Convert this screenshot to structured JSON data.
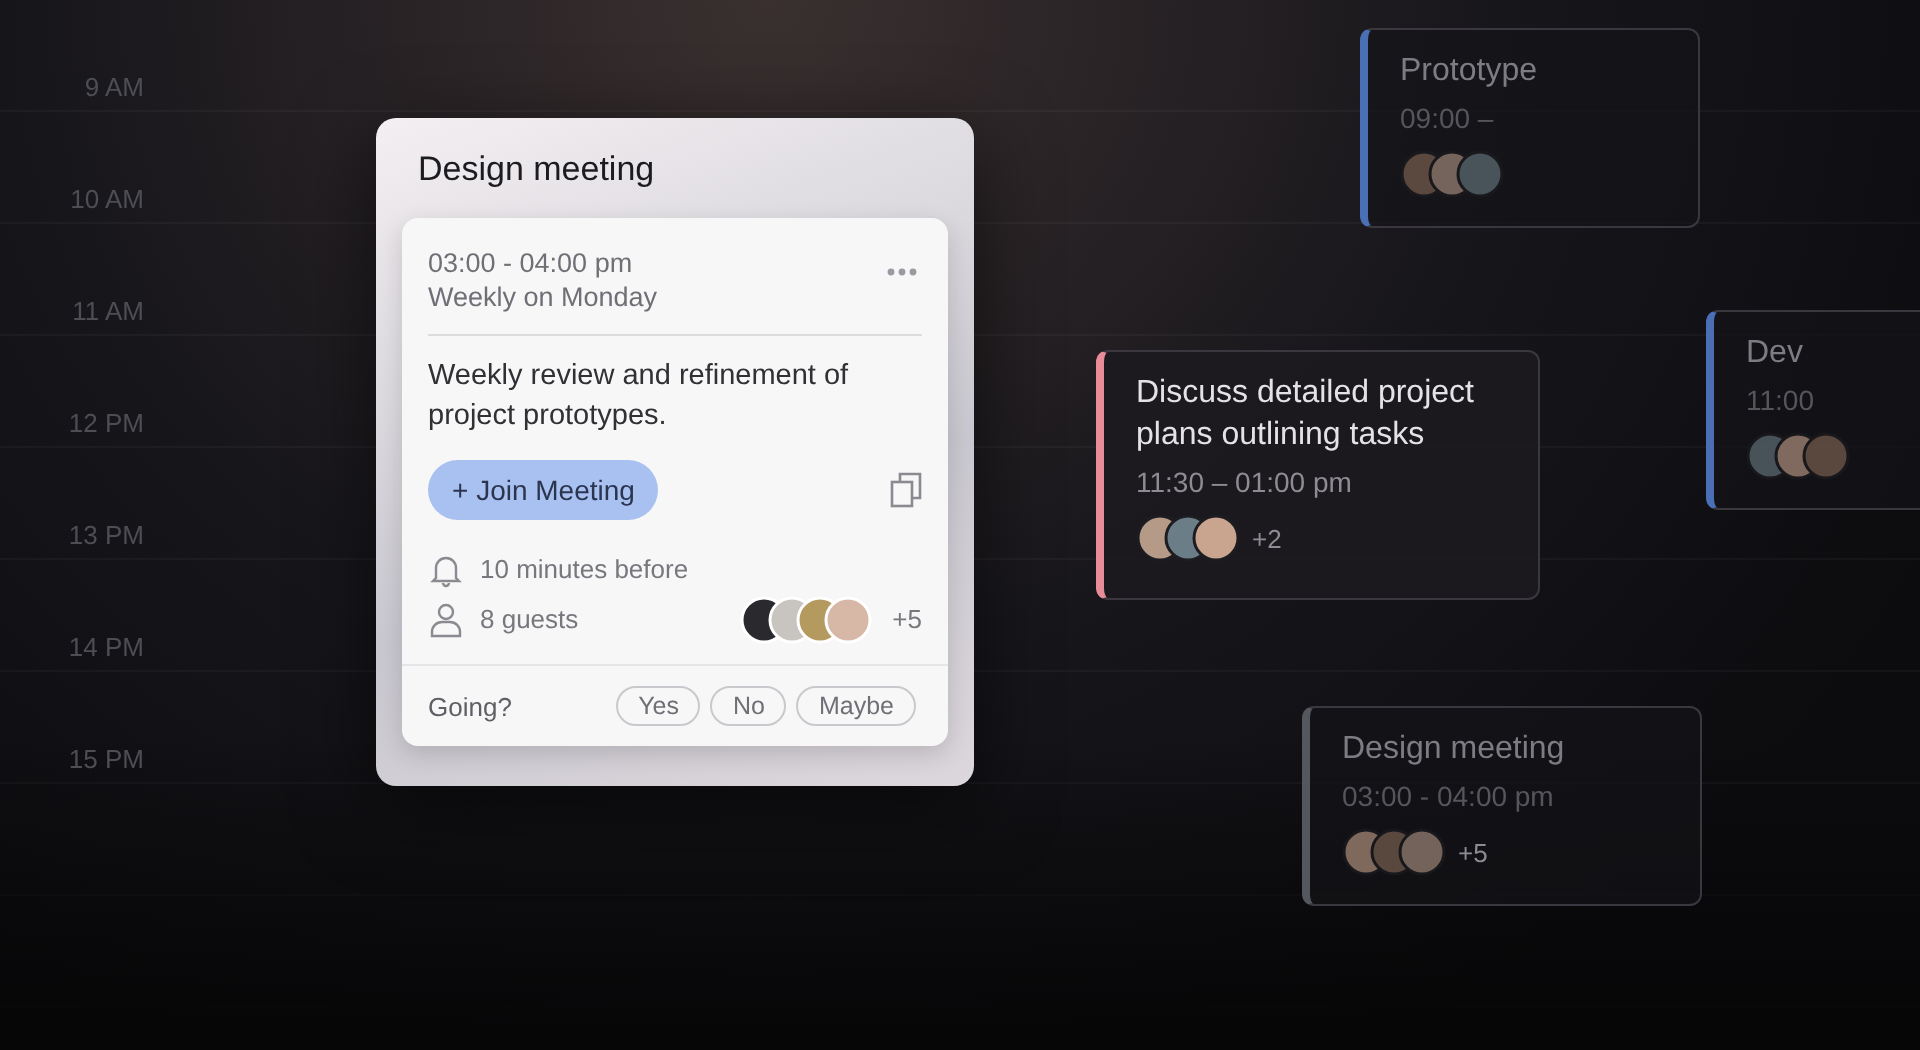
{
  "times": [
    "9 AM",
    "10 AM",
    "11 AM",
    "12 PM",
    "13 PM",
    "14 PM",
    "15 PM"
  ],
  "events": [
    {
      "title": "Prototype",
      "time": "09:00 –",
      "color": "#4a6fb5",
      "faded": true
    },
    {
      "title": "Discuss detailed project plans outlining tasks",
      "time": "11:30 – 01:00 pm",
      "extra": "+2",
      "color": "#e88c9a",
      "faded": false
    },
    {
      "title": "Dev",
      "time": "11:00",
      "color": "#4a6fb5",
      "faded": true
    },
    {
      "title": "Design meeting",
      "time": "03:00 - 04:00 pm",
      "extra": "+5",
      "color": "#55575e",
      "faded": true
    }
  ],
  "popup": {
    "title": "Design meeting",
    "time": "03:00 - 04:00 pm",
    "recurrence": "Weekly on Monday",
    "description": "Weekly review and refinement of project prototypes.",
    "join_button": "+ Join Meeting",
    "reminder": "10 minutes before",
    "guests": "8 guests",
    "guests_extra": "+5",
    "going_label": "Going?",
    "rsvp": [
      {
        "label": "Yes",
        "selected": false
      },
      {
        "label": "No",
        "selected": false
      },
      {
        "label": "Maybe",
        "selected": false
      }
    ]
  }
}
